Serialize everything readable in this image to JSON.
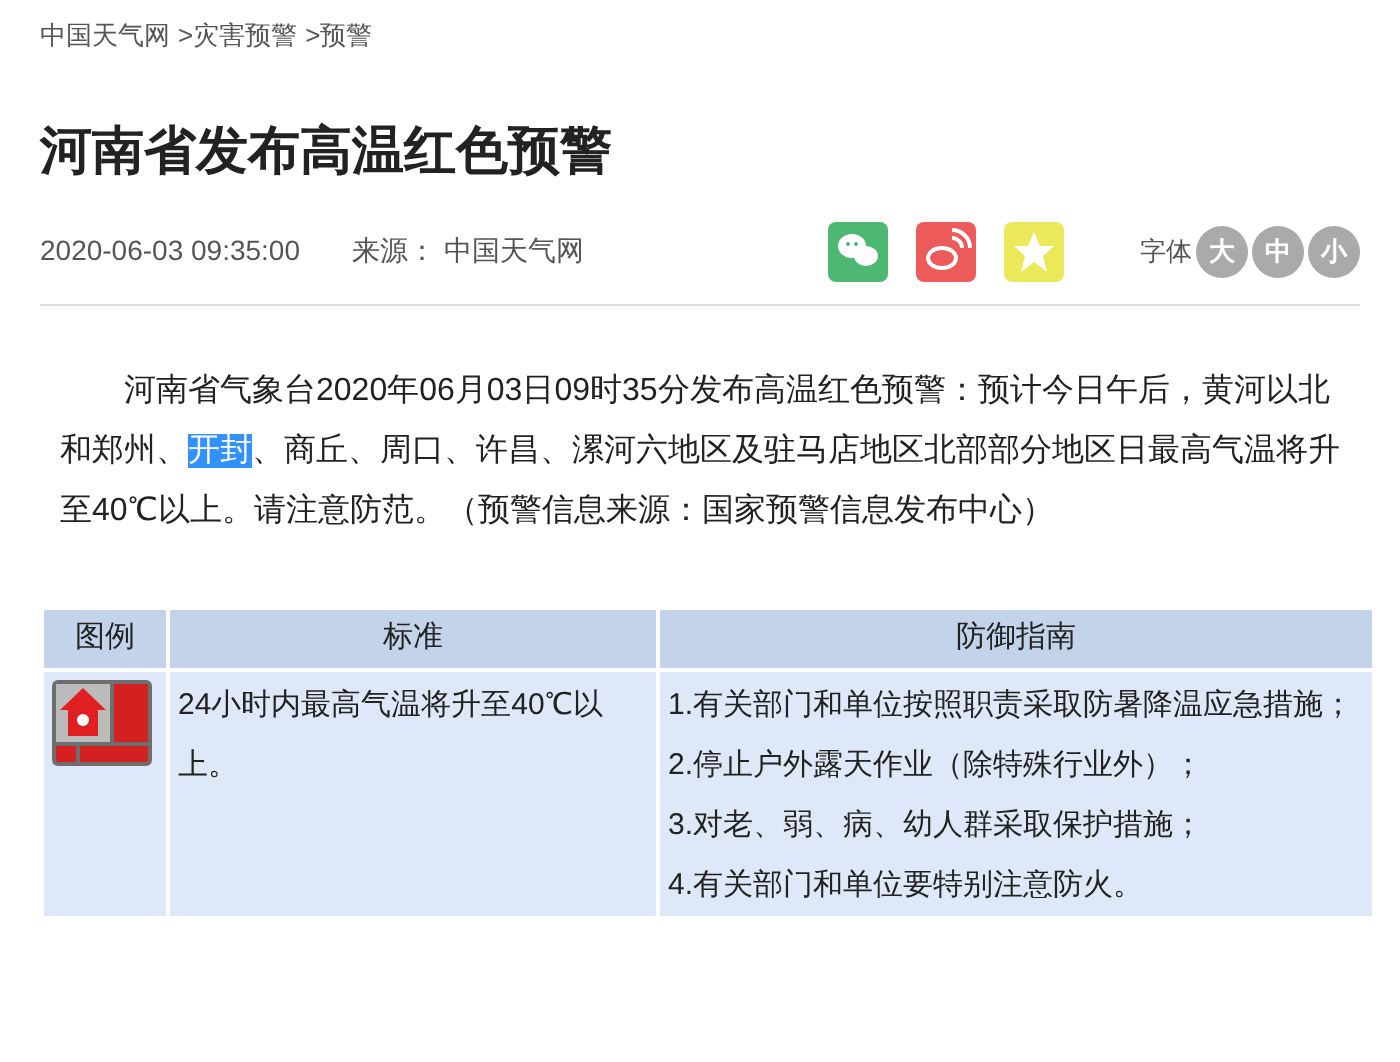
{
  "breadcrumb": [
    "中国天气网",
    ">灾害预警",
    ">预警"
  ],
  "title": "河南省发布高温红色预警",
  "meta": {
    "time": "2020-06-03 09:35:00",
    "source_label": "来源：",
    "source": "中国天气网"
  },
  "share": [
    {
      "kind": "wechat",
      "color": "#4cb871"
    },
    {
      "kind": "weibo",
      "color": "#ec5a5a"
    },
    {
      "kind": "favorite",
      "color": "#ebe85a"
    }
  ],
  "font_size": {
    "label": "字体",
    "options": [
      "大",
      "中",
      "小"
    ]
  },
  "paragraph": [
    {
      "text": "河南省气象台2020年06月03日09时35分发布高温红色预警：预计今日午后，黄河以北和郑州、",
      "selected": false
    },
    {
      "text": "开封",
      "selected": true
    },
    {
      "text": "、商丘、周口、许昌、漯河六地区及驻马店地区北部部分地区日最高气温将升至40℃以上。请注意防范。（预警信息来源：国家预警信息发布中心）",
      "selected": false
    }
  ],
  "table": {
    "columns": [
      "图例",
      "标准",
      "防御指南"
    ],
    "rows": [
      {
        "standard": "24小时内最高气温将升至40℃以上。",
        "guide": [
          "1.有关部门和单位按照职责采取防暑降温应急措施；",
          "2.停止户外露天作业（除特殊行业外）；",
          "3.对老、弱、病、幼人群采取保护措施；",
          "4.有关部门和单位要特别注意防火。"
        ]
      }
    ]
  }
}
